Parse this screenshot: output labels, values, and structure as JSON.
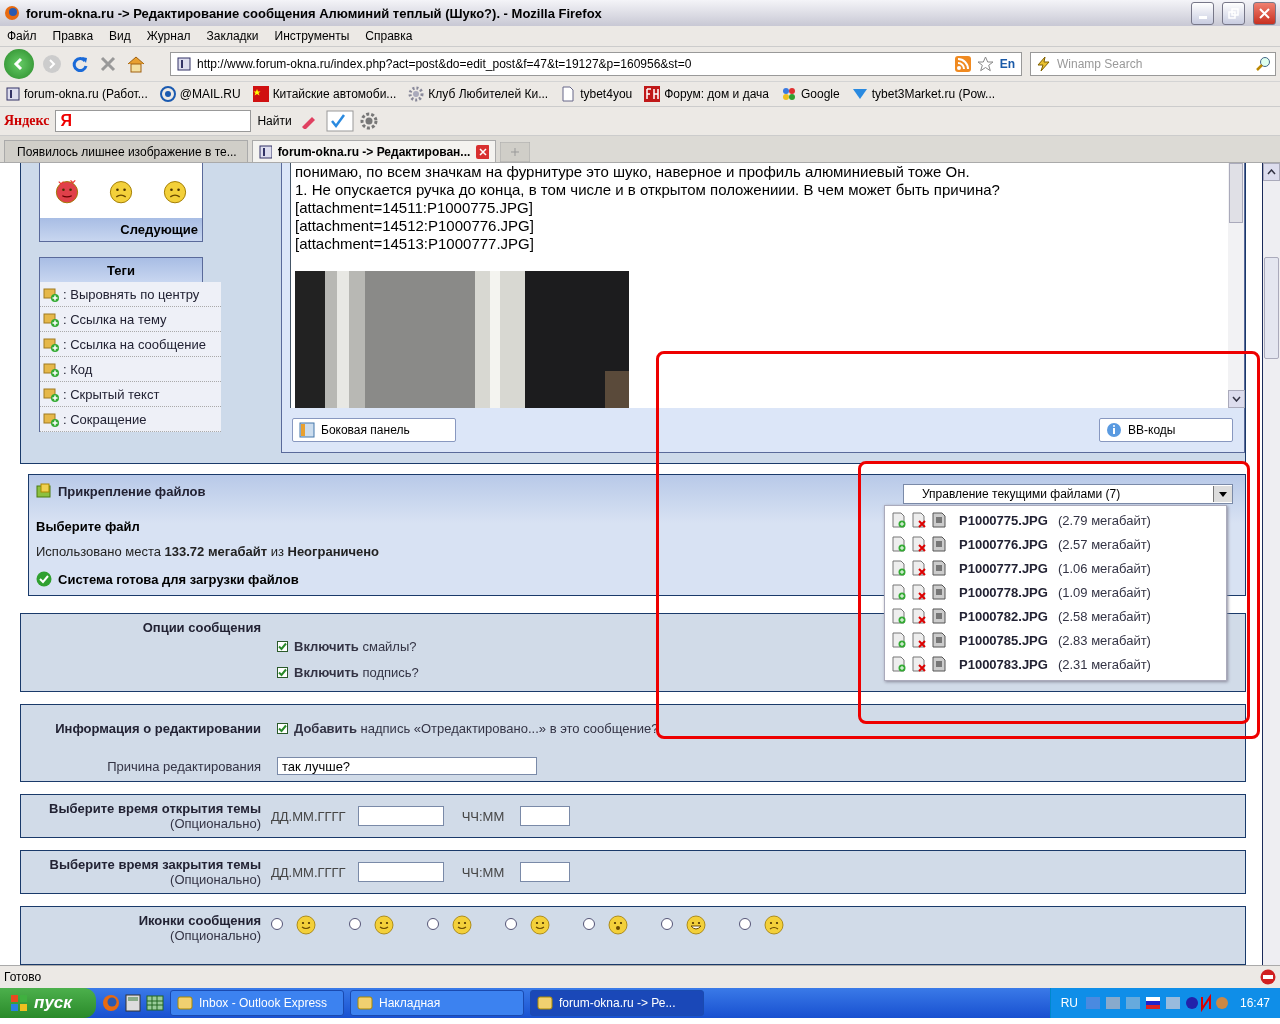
{
  "window": {
    "title": "forum-okna.ru -> Редактирование сообщения Алюминий теплый (Шуко?). - Mozilla Firefox"
  },
  "menu": [
    "Файл",
    "Правка",
    "Вид",
    "Журнал",
    "Закладки",
    "Инструменты",
    "Справка"
  ],
  "navbar": {
    "url": "http://www.forum-okna.ru/index.php?act=post&do=edit_post&f=47&t=19127&p=160956&st=0",
    "lang": "En",
    "search_placeholder": "Winamp Search"
  },
  "bookmarks": [
    {
      "label": "forum-okna.ru (Работ...",
      "kind": "site"
    },
    {
      "label": "@MAIL.RU",
      "kind": "mail"
    },
    {
      "label": "Китайские автомоби...",
      "kind": "flag"
    },
    {
      "label": "Клуб Любителей Ки...",
      "kind": "gear"
    },
    {
      "label": "tybet4you",
      "kind": "page"
    },
    {
      "label": "Форум: дом и дача",
      "kind": "fh"
    },
    {
      "label": "Google",
      "kind": "google"
    },
    {
      "label": "tybet3Market.ru (Pow...",
      "kind": "market"
    }
  ],
  "yandex": {
    "brand": "Яндекс",
    "logo": "Я",
    "find_button": "Найти"
  },
  "tabs": [
    {
      "label": "Появилось лишнее изображение в те...",
      "selected": false
    },
    {
      "label": "forum-okna.ru -> Редактирован...",
      "selected": true
    }
  ],
  "sidebar": {
    "smilies": [
      {
        "kind": "love"
      },
      {
        "kind": "angry"
      },
      {
        "kind": "sad"
      }
    ],
    "next": "Следующие",
    "tags_title": "Теги",
    "tags": [
      ": Выровнять по центру",
      ": Ссылка на тему",
      ": Ссылка на сообщение",
      ": Код",
      ": Скрытый текст",
      ": Сокращение"
    ]
  },
  "editor": {
    "lines": [
      "понимаю, по всем значкам на фурнитуре это шуко, наверное и профиль алюминиевый тоже Он.",
      "1. Не опускается ручка до конца, в том числе и в открытом положениии. В чем может быть причина?",
      "[attachment=14511:P1000775.JPG]",
      "[attachment=14512:P1000776.JPG]",
      "[attachment=14513:P1000777.JPG]"
    ],
    "sidebar_button": "Боковая панель",
    "bbcode_button": "BB-коды"
  },
  "attachments": {
    "title": "Прикрепление файлов",
    "choose": "Выберите файл",
    "usage": "Использовано места **133.72 мегабайт** из **Неограничено**",
    "status": "Система готова для загрузки файлов",
    "manager": "Управление текущими файлами (7)",
    "files": [
      {
        "name": "P1000775.JPG",
        "size": "(2.79 мегабайт)"
      },
      {
        "name": "P1000776.JPG",
        "size": "(2.57 мегабайт)"
      },
      {
        "name": "P1000777.JPG",
        "size": "(1.06 мегабайт)"
      },
      {
        "name": "P1000778.JPG",
        "size": "(1.09 мегабайт)"
      },
      {
        "name": "P1000782.JPG",
        "size": "(2.58 мегабайт)"
      },
      {
        "name": "P1000785.JPG",
        "size": "(2.83 мегабайт)"
      },
      {
        "name": "P1000783.JPG",
        "size": "(2.31 мегабайт)"
      }
    ]
  },
  "options": {
    "label": "Опции сообщения",
    "checkboxes": [
      {
        "text": "**Включить** смайлы?",
        "checked": true
      },
      {
        "text": "**Включить** подпись?",
        "checked": true
      }
    ]
  },
  "edit_info": {
    "label": "Информация о редактировании",
    "checkbox": {
      "text": "**Добавить** надпись «Отредактировано...» в это сообщение?",
      "checked": true
    },
    "reason_label": "Причина редактирования",
    "reason_value": "так лучше?"
  },
  "times": [
    {
      "label": "Выберите время открытия темы",
      "note": "(Опционально)",
      "date_label": "ДД.ММ.ГГГГ",
      "time_label": "ЧЧ:ММ"
    },
    {
      "label": "Выберите время закрытия темы",
      "note": "(Опционально)",
      "date_label": "ДД.ММ.ГГГГ",
      "time_label": "ЧЧ:ММ"
    }
  ],
  "post_icons": {
    "label": "Иконки сообщения",
    "note": "(Опционально)",
    "icons": [
      {
        "kind": "smile",
        "selected": false
      },
      {
        "kind": "whistle",
        "selected": false
      },
      {
        "kind": "wink",
        "selected": false
      },
      {
        "kind": "happy",
        "selected": false
      },
      {
        "kind": "surprised",
        "selected": false
      },
      {
        "kind": "grin",
        "selected": false
      },
      {
        "kind": "angry",
        "selected": false
      }
    ]
  },
  "status_bar": {
    "text": "Готово"
  },
  "taskbar": {
    "start": "пуск",
    "items": [
      {
        "label": "Inbox - Outlook Express",
        "selected": false
      },
      {
        "label": "Накладная",
        "selected": false
      },
      {
        "label": "forum-okna.ru -> Ре...",
        "selected": true
      }
    ],
    "lang": "RU",
    "clock": "16:47"
  }
}
